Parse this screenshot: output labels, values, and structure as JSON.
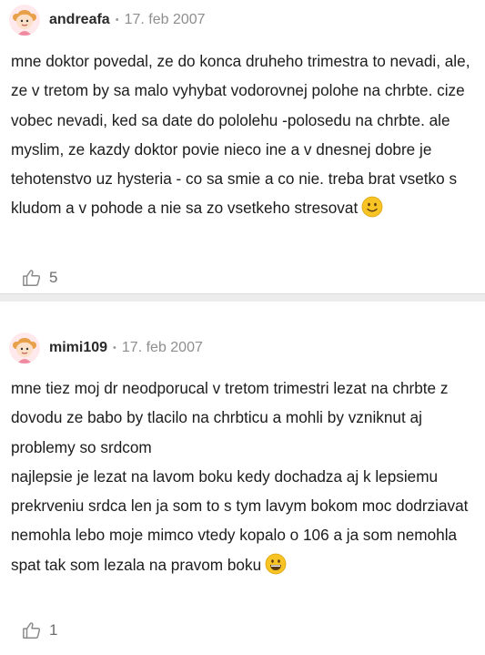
{
  "comments": [
    {
      "username": "andreafa",
      "separator": "•",
      "date": "17. feb 2007",
      "paragraphs": [
        "mne doktor povedal, ze do konca druheho trimestra to nevadi, ale, ze v tretom by sa malo vyhybat vodorovnej polohe na chrbte. cize vobec nevadi, ked sa date do pololehu -polosedu na chrbte. ale myslim, ze kazdy doktor povie nieco ine a v dnesnej dobre je tehotenstvo uz hysteria - co sa smie a co nie. treba brat vsetko s kludom a v pohode a nie sa zo vsetkeho stresovat"
      ],
      "emoji": "slightly-smiling-face",
      "like_icon": "thumbs-up-outline-icon",
      "likes": "5"
    },
    {
      "username": "mimi109",
      "separator": "•",
      "date": "17. feb 2007",
      "paragraphs": [
        "mne tiez moj dr neodporucal v tretom trimestri lezat na chrbte z dovodu ze babo by tlacilo na chrbticu a mohli by vzniknut aj problemy so srdcom",
        "najlepsie je lezat na lavom boku kedy dochadza aj k lepsiemu prekrveniu srdca len ja som to s tym lavym bokom moc dodrziavat nemohla lebo moje mimco vtedy kopalo o 106 a ja som nemohla spat tak som lezala na pravom boku"
      ],
      "emoji": "grinning-face",
      "like_icon": "thumbs-up-outline-icon",
      "likes": "1"
    }
  ],
  "colors": {
    "divider": "#ececec",
    "username": "#2a2a2a",
    "meta": "#8e8e8e",
    "emoji": "#f7c325"
  }
}
